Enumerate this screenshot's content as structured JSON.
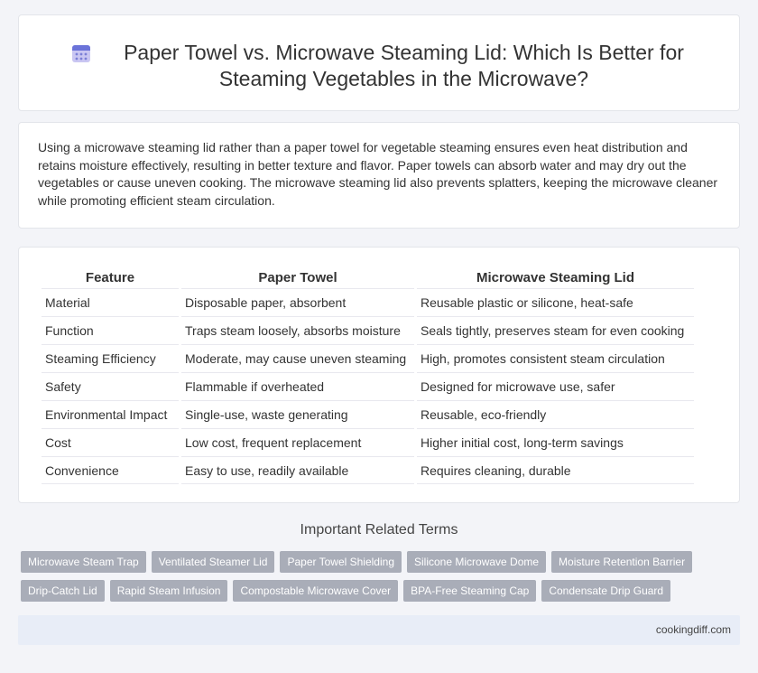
{
  "header": {
    "title": "Paper Towel vs. Microwave Steaming Lid: Which Is Better for Steaming Vegetables in the Microwave?",
    "icon": "calendar-icon"
  },
  "intro": {
    "text": "Using a microwave steaming lid rather than a paper towel for vegetable steaming ensures even heat distribution and retains moisture effectively, resulting in better texture and flavor. Paper towels can absorb water and may dry out the vegetables or cause uneven cooking. The microwave steaming lid also prevents splatters, keeping the microwave cleaner while promoting efficient steam circulation."
  },
  "table": {
    "headers": [
      "Feature",
      "Paper Towel",
      "Microwave Steaming Lid"
    ],
    "rows": [
      [
        "Material",
        "Disposable paper, absorbent",
        "Reusable plastic or silicone, heat-safe"
      ],
      [
        "Function",
        "Traps steam loosely, absorbs moisture",
        "Seals tightly, preserves steam for even cooking"
      ],
      [
        "Steaming Efficiency",
        "Moderate, may cause uneven steaming",
        "High, promotes consistent steam circulation"
      ],
      [
        "Safety",
        "Flammable if overheated",
        "Designed for microwave use, safer"
      ],
      [
        "Environmental Impact",
        "Single-use, waste generating",
        "Reusable, eco-friendly"
      ],
      [
        "Cost",
        "Low cost, frequent replacement",
        "Higher initial cost, long-term savings"
      ],
      [
        "Convenience",
        "Easy to use, readily available",
        "Requires cleaning, durable"
      ]
    ]
  },
  "related": {
    "title": "Important Related Terms",
    "tags_row1": [
      "Microwave Steam Trap",
      "Ventilated Steamer Lid",
      "Paper Towel Shielding",
      "Silicone Microwave Dome",
      "Moisture Retention Barrier"
    ],
    "tags_row2": [
      "Drip-Catch Lid",
      "Rapid Steam Infusion",
      "Compostable Microwave Cover",
      "BPA-Free Steaming Cap",
      "Condensate Drip Guard"
    ]
  },
  "footer": {
    "site": "cookingdiff.com"
  },
  "colors": {
    "background": "#f3f4f8",
    "tag_bg": "#a9adb8",
    "footer_bg": "#e8edf7"
  }
}
